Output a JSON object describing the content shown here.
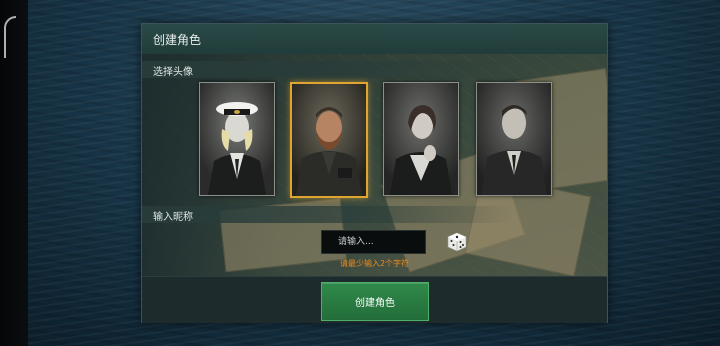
{
  "dialog": {
    "title": "创建角色",
    "avatar_section_label": "选择头像",
    "nickname_section_label": "输入昵称",
    "input_placeholder": "请输入...",
    "warning": "请最少输入2个字符",
    "create_button": "创建角色",
    "selected_avatar_index": 1,
    "accent_color": "#e0a531",
    "button_color": "#2f8a4b",
    "warning_color": "#f08a1d"
  },
  "avatars": [
    {
      "icon": "female-navy-officer-portrait-icon"
    },
    {
      "icon": "bearded-captain-portrait-icon"
    },
    {
      "icon": "female-officer-portrait-icon"
    },
    {
      "icon": "male-officer-portrait-icon"
    }
  ],
  "icons": {
    "dice": "dice-icon"
  }
}
